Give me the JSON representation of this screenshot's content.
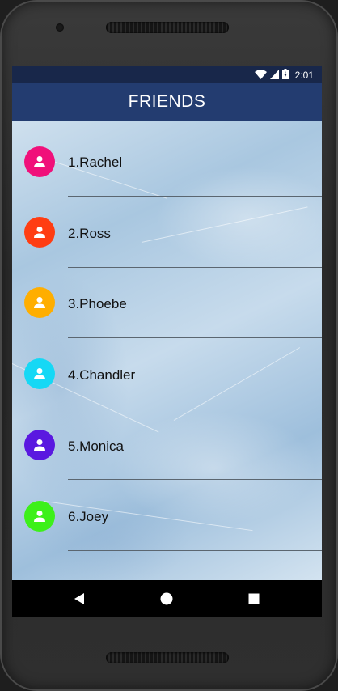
{
  "status_bar": {
    "time": "2:01",
    "icons": [
      "wifi-icon",
      "signal-icon",
      "battery-icon"
    ]
  },
  "app_bar": {
    "title": "FRIENDS"
  },
  "friends": [
    {
      "label": "1.Rachel",
      "color": "#f0107a"
    },
    {
      "label": "2.Ross",
      "color": "#ff3d12"
    },
    {
      "label": "3.Phoebe",
      "color": "#ffae00"
    },
    {
      "label": "4.Chandler",
      "color": "#16d8f5"
    },
    {
      "label": "5.Monica",
      "color": "#5a18e0"
    },
    {
      "label": "6.Joey",
      "color": "#3df01a"
    }
  ],
  "nav_bar": {
    "buttons": [
      "back-icon",
      "home-icon",
      "recents-icon"
    ]
  },
  "colors": {
    "status_bar": "#18274a",
    "app_bar": "#233c70",
    "nav_bar": "#000000"
  }
}
